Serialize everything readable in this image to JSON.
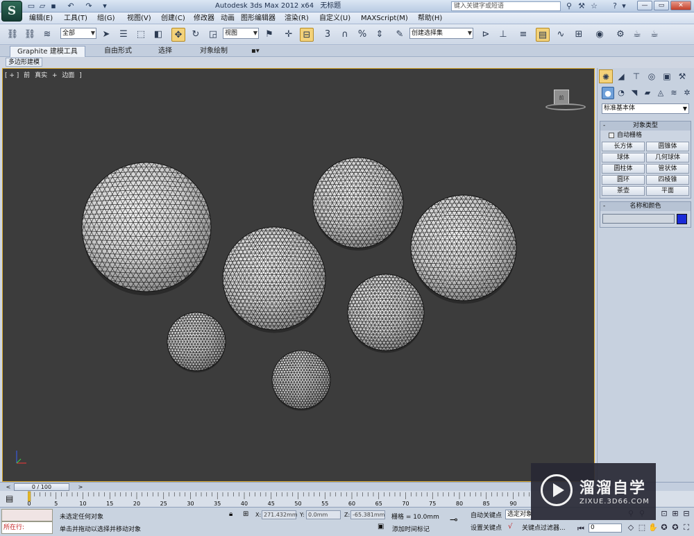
{
  "window": {
    "app_title": "Autodesk 3ds Max  2012 x64",
    "doc_title": "无标题",
    "search_placeholder": "键入关键字或短语"
  },
  "menu": [
    "编辑(E)",
    "工具(T)",
    "组(G)",
    "视图(V)",
    "创建(C)",
    "修改器",
    "动画",
    "图形编辑器",
    "渲染(R)",
    "自定义(U)",
    "MAXScript(M)",
    "帮助(H)"
  ],
  "toolbar": {
    "selection_filter": "全部",
    "reference_coord": "视图",
    "named_selection": "创建选择集"
  },
  "ribbon": {
    "tabs": [
      "Graphite 建模工具",
      "自由形式",
      "选择",
      "对象绘制"
    ],
    "subtab": "多边形建模"
  },
  "viewport": {
    "label_parts": [
      "[ + ]",
      "前",
      "真实",
      "+",
      "边面",
      "]"
    ],
    "viewcube_face": "前",
    "bg_color": "#3c3c3c",
    "border_color": "#d9a82a"
  },
  "command_panel": {
    "category": "标准基本体",
    "object_type_title": "对象类型",
    "autogrid_label": "自动栅格",
    "object_buttons": [
      "长方体",
      "圆锥体",
      "球体",
      "几何球体",
      "圆柱体",
      "管状体",
      "圆环",
      "四棱锥",
      "茶壶",
      "平面"
    ],
    "name_color_title": "名称和颜色",
    "object_color": "#1a2bd8",
    "rollout_sign": "-"
  },
  "timeline": {
    "frame_display": "0 / 100",
    "ticks": [
      "0",
      "5",
      "10",
      "15",
      "20",
      "25",
      "30",
      "35",
      "40",
      "45",
      "50",
      "55",
      "60",
      "65",
      "70",
      "75",
      "80",
      "85",
      "90"
    ]
  },
  "status": {
    "maxscript_label": "所在行:",
    "selection_status": "未选定任何对象",
    "prompt": "单击并拖动以选择并移动对象",
    "x_label": "X:",
    "x_value": "271.432mm",
    "y_label": "Y:",
    "y_value": "0.0mm",
    "z_label": "Z:",
    "z_value": "-65.381mm",
    "grid": "栅格 = 10.0mm",
    "add_time_tag": "添加时间标记",
    "auto_key": "自动关键点",
    "selected_label": "选定对象",
    "set_key": "设置关键点",
    "key_filters": "关键点过滤器...",
    "current_frame": "0"
  },
  "watermark": {
    "title": "溜溜自学",
    "subtitle": "ZIXUE.3D66.COM"
  },
  "icons": {
    "app_logo": "3ds-max-logo-icon",
    "sphere_render": "geosphere-wireframe"
  }
}
